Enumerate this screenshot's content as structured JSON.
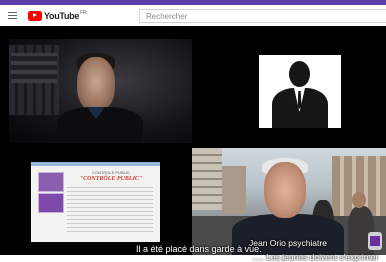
{
  "header": {
    "logo_text": "YouTube",
    "logo_region": "FR",
    "search_placeholder": "Rechercher"
  },
  "video": {
    "tile1_badge": "",
    "captions": {
      "line_top": "Jean Orio psychiatre",
      "line_main": "Il a été placé dans garde à vue.",
      "line_bottom": "..... Les jeunes doivent s'exprimer"
    },
    "website": {
      "title": "CONTROLE PUBLIC",
      "headline": "\"CONTRÔLE PUBLIC\""
    }
  },
  "colors": {
    "youtube_red": "#ff0000",
    "player_bg": "#000000",
    "accent_purple": "#5b3fa6",
    "headline_red": "#d33a2c"
  }
}
